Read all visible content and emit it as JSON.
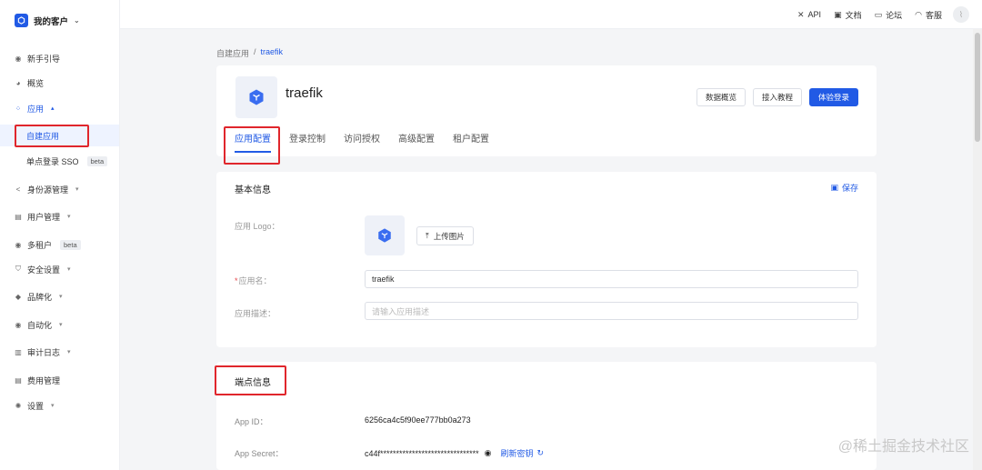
{
  "org": {
    "name": "我的客户"
  },
  "sidebar": {
    "items": [
      {
        "label": "新手引导",
        "icon": "compass-icon",
        "chevron": ""
      },
      {
        "label": "概览",
        "icon": "pie-icon",
        "chevron": ""
      },
      {
        "label": "应用",
        "icon": "apps-icon",
        "chevron": "▴"
      },
      {
        "label": "自建应用",
        "icon": "",
        "chevron": ""
      },
      {
        "label": "单点登录 SSO",
        "icon": "",
        "chevron": "",
        "badge": "beta"
      },
      {
        "label": "身份源管理",
        "icon": "share-icon",
        "chevron": "▾"
      },
      {
        "label": "用户管理",
        "icon": "users-icon",
        "chevron": "▾"
      },
      {
        "label": "多租户",
        "icon": "tenant-icon",
        "chevron": "",
        "badge": "beta"
      },
      {
        "label": "安全设置",
        "icon": "shield-icon",
        "chevron": "▾"
      },
      {
        "label": "品牌化",
        "icon": "brush-icon",
        "chevron": "▾"
      },
      {
        "label": "自动化",
        "icon": "robot-icon",
        "chevron": "▾"
      },
      {
        "label": "审计日志",
        "icon": "log-icon",
        "chevron": "▾"
      },
      {
        "label": "费用管理",
        "icon": "bill-icon",
        "chevron": ""
      },
      {
        "label": "设置",
        "icon": "gear-icon",
        "chevron": "▾"
      }
    ]
  },
  "topbar": {
    "api": "API",
    "docs": "文档",
    "forum": "论坛",
    "support": "客服"
  },
  "breadcrumb": {
    "parent": "自建应用",
    "separator": "/",
    "current": "traefik"
  },
  "app": {
    "name": "traefik",
    "buttons": {
      "overview": "数据概览",
      "tutorial": "接入教程",
      "try_login": "体验登录"
    },
    "tabs": [
      "应用配置",
      "登录控制",
      "访问授权",
      "高级配置",
      "租户配置"
    ]
  },
  "basic_info": {
    "title": "基本信息",
    "save": "保存",
    "logo_label": "应用 Logo：",
    "upload": "上传图片",
    "name_label": "应用名：",
    "name_value": "traefik",
    "desc_label": "应用描述：",
    "desc_placeholder": "请输入应用描述"
  },
  "endpoint": {
    "title": "端点信息",
    "app_id_label": "App ID：",
    "app_id": "6256ca4c5f90ee777bb0a273",
    "app_secret_label": "App Secret：",
    "app_secret": "c44f*******************************",
    "refresh": "刷新密钥"
  },
  "watermark": "@稀土掘金技术社区",
  "colors": {
    "primary": "#215ae5",
    "highlight": "#e0262c"
  }
}
